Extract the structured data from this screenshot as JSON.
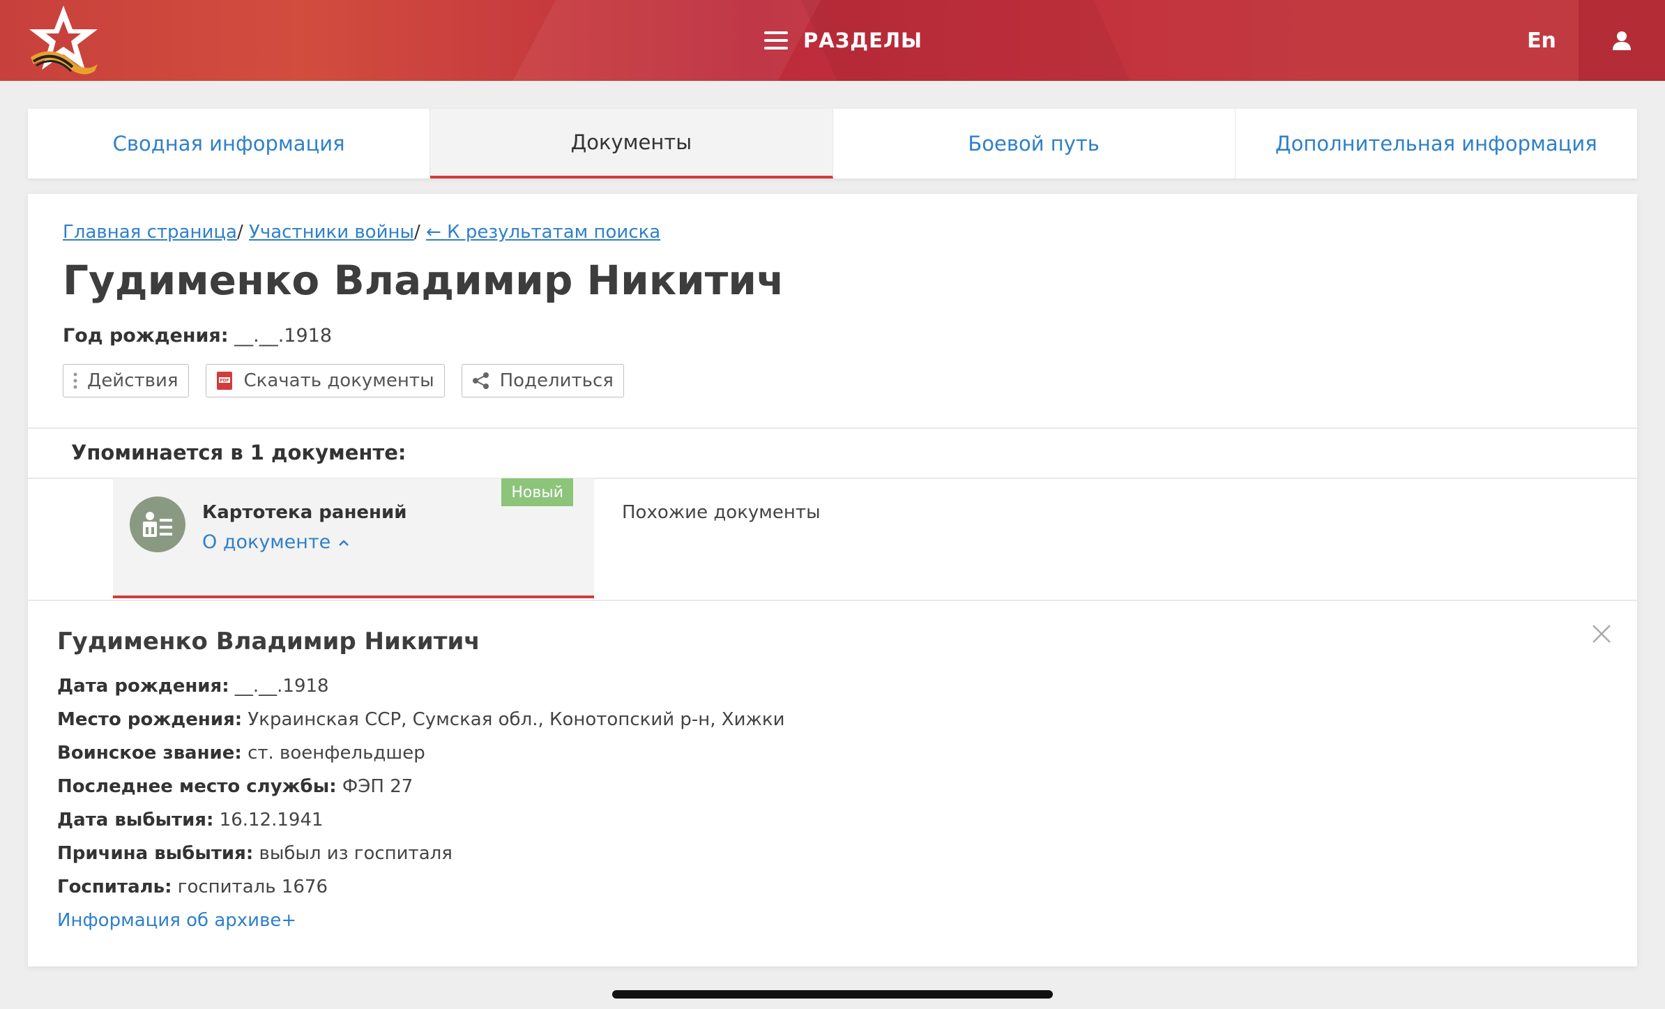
{
  "header": {
    "menu_label": "РАЗДЕЛЫ",
    "lang_label": "En"
  },
  "tabs": [
    {
      "label": "Сводная информация",
      "active": false
    },
    {
      "label": "Документы",
      "active": true
    },
    {
      "label": "Боевой путь",
      "active": false
    },
    {
      "label": "Дополнительная информация",
      "active": false
    }
  ],
  "breadcrumb": {
    "home": "Главная страница",
    "participants": "Участники войны",
    "back": "← К результатам поиска",
    "separator": "/"
  },
  "person": {
    "name": "Гудименко Владимир Никитич",
    "birth_label": "Год рождения:",
    "birth_value": "__.__.1918"
  },
  "actions": {
    "actions_label": "Действия",
    "download_label": "Скачать документы",
    "share_label": "Поделиться"
  },
  "mentions_title": "Упоминается в 1 документе:",
  "document": {
    "name": "Картотека ранений",
    "about_label": "О документе",
    "badge": "Новый"
  },
  "similar_label": "Похожие документы",
  "details": {
    "title": "Гудименко Владимир Никитич",
    "rows": [
      {
        "label": "Дата рождения:",
        "value": "__.__.1918"
      },
      {
        "label": "Место рождения:",
        "value": "Украинская ССР, Сумская обл., Конотопский р-н, Хижки"
      },
      {
        "label": "Воинское звание:",
        "value": "ст. военфельдшер"
      },
      {
        "label": "Последнее место службы:",
        "value": "ФЭП 27"
      },
      {
        "label": "Дата выбытия:",
        "value": "16.12.1941"
      },
      {
        "label": "Причина выбытия:",
        "value": "выбыл из госпиталя"
      },
      {
        "label": "Госпиталь:",
        "value": "госпиталь 1676"
      }
    ],
    "archive_link": "Информация об архиве+"
  },
  "colors": {
    "header_red": "#c23a40",
    "link_blue": "#2f80c9",
    "accent_red": "#d23c3c",
    "badge_green": "#8cc47a"
  }
}
